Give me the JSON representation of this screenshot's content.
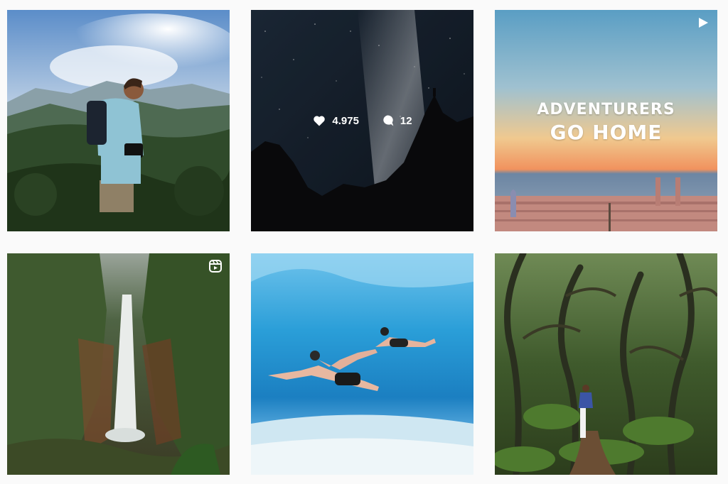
{
  "posts": [
    {
      "id": "hiker-mountain",
      "type": "photo"
    },
    {
      "id": "milky-way",
      "type": "photo",
      "hover": {
        "likes": "4.975",
        "comments": "12"
      }
    },
    {
      "id": "adventurers-go-home",
      "type": "video",
      "badge_icon": "play-icon",
      "poster_text": [
        "ADVENTURERS",
        "GO HOME"
      ]
    },
    {
      "id": "waterfall",
      "type": "reel",
      "badge_icon": "reel-icon"
    },
    {
      "id": "freedivers",
      "type": "photo"
    },
    {
      "id": "forest-hiker",
      "type": "photo"
    }
  ],
  "colors": {
    "page_bg": "#fafafa",
    "overlay_text": "#ffffff"
  }
}
